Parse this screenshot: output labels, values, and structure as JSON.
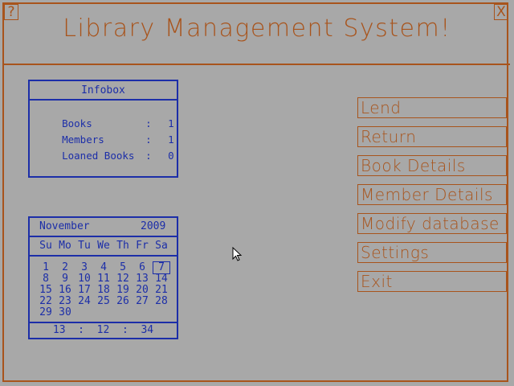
{
  "window": {
    "title": "Library Management System!",
    "help_label": "?",
    "close_label": "X"
  },
  "infobox": {
    "heading": "Infobox",
    "rows": [
      {
        "label": "Books",
        "sep": ":",
        "value": "1"
      },
      {
        "label": "Members",
        "sep": ":",
        "value": "1"
      },
      {
        "label": "Loaned Books",
        "sep": ":",
        "value": "0"
      }
    ]
  },
  "calendar": {
    "month": "November",
    "year": "2009",
    "weekdays": [
      "Su",
      "Mo",
      "Tu",
      "We",
      "Th",
      "Fr",
      "Sa"
    ],
    "weeks": [
      [
        "1",
        "2",
        "3",
        "4",
        "5",
        "6",
        "7"
      ],
      [
        "8",
        "9",
        "10",
        "11",
        "12",
        "13",
        "14"
      ],
      [
        "15",
        "16",
        "17",
        "18",
        "19",
        "20",
        "21"
      ],
      [
        "22",
        "23",
        "24",
        "25",
        "26",
        "27",
        "28"
      ],
      [
        "29",
        "30",
        "",
        "",
        "",
        "",
        ""
      ]
    ],
    "today": "7",
    "time": "13  :  12  :  34"
  },
  "menu": {
    "items": [
      {
        "label": "Lend"
      },
      {
        "label": "Return"
      },
      {
        "label": "Book Details"
      },
      {
        "label": "Member Details"
      },
      {
        "label": "Modify database"
      },
      {
        "label": "Settings"
      },
      {
        "label": "Exit"
      }
    ]
  },
  "colors": {
    "accent": "#a8541c",
    "panel": "#1c2ea8",
    "background": "#a8a8a8"
  }
}
